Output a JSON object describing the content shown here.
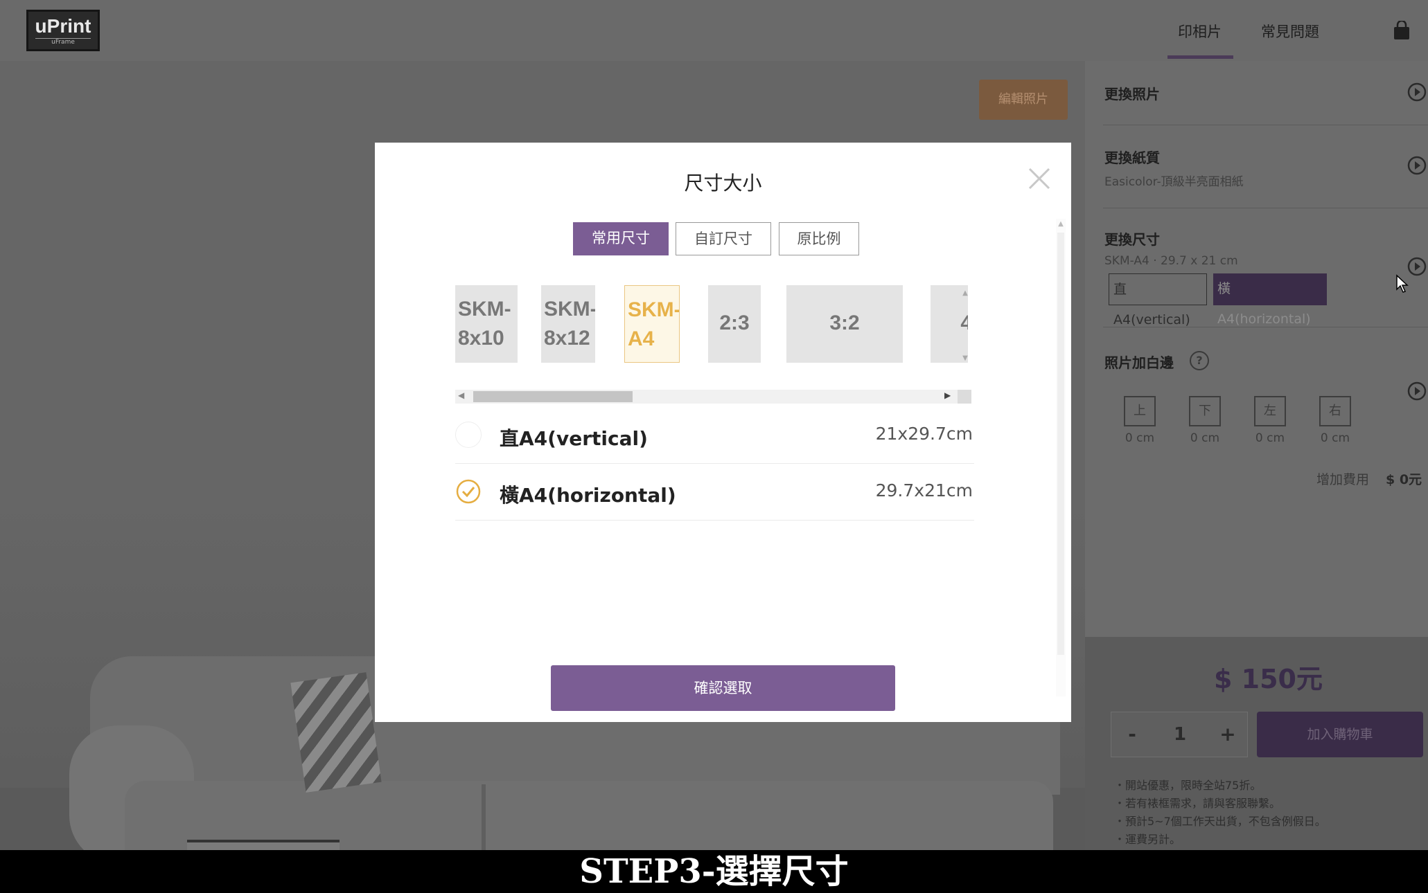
{
  "header": {
    "logo_main": "uPrint",
    "logo_sub": "uFrame",
    "nav": [
      "印相片",
      "常見問題"
    ],
    "cart_icon": "shopping-bag-icon"
  },
  "canvas": {
    "edit_photo_label": "編輯照片"
  },
  "panel": {
    "change_photo": "更換照片",
    "change_paper": "更換紙質",
    "paper_value": "Easicolor-頂級半亮面相紙",
    "change_size": "更換尺寸",
    "size_value": "SKM-A4 · 29.7 x 21 cm",
    "size_options": [
      "直A4(vertical)",
      "橫A4(horizontal)"
    ],
    "border_title": "照片加白邊",
    "help_icon_text": "?",
    "borders": [
      {
        "label": "上",
        "value": "0 cm"
      },
      {
        "label": "下",
        "value": "0 cm"
      },
      {
        "label": "左",
        "value": "0 cm"
      },
      {
        "label": "右",
        "value": "0 cm"
      }
    ],
    "extra_fee_label": "增加費用",
    "extra_fee_value": "$ 0元",
    "price": "$ 150元",
    "qty_minus": "-",
    "qty_value": "1",
    "qty_plus": "+",
    "add_to_cart": "加入購物車",
    "notes": [
      "・開站優惠，限時全站75折。",
      "・若有裱框需求，請與客服聯繫。",
      "・預計5~7個工作天出貨，不包含例假日。",
      "・運費另計。"
    ]
  },
  "modal": {
    "title": "尺寸大小",
    "tabs": [
      "常用尺寸",
      "自訂尺寸",
      "原比例"
    ],
    "size_cards": [
      "SKM-\n8x10",
      "SKM-\n8x12",
      "SKM-\nA4",
      "2:3",
      "3:2",
      "4"
    ],
    "selected_card": "SKM-A4",
    "options": [
      {
        "label": "直A4(vertical)",
        "dimension": "21x29.7cm",
        "checked": false
      },
      {
        "label": "橫A4(horizontal)",
        "dimension": "29.7x21cm",
        "checked": true
      }
    ],
    "confirm_label": "確認選取"
  },
  "caption": "STEP3-選擇尺寸",
  "colors": {
    "accent_purple": "#7b5d94",
    "selected_gold": "#e7b24a",
    "overlay_dark": "#5e5e5e"
  }
}
